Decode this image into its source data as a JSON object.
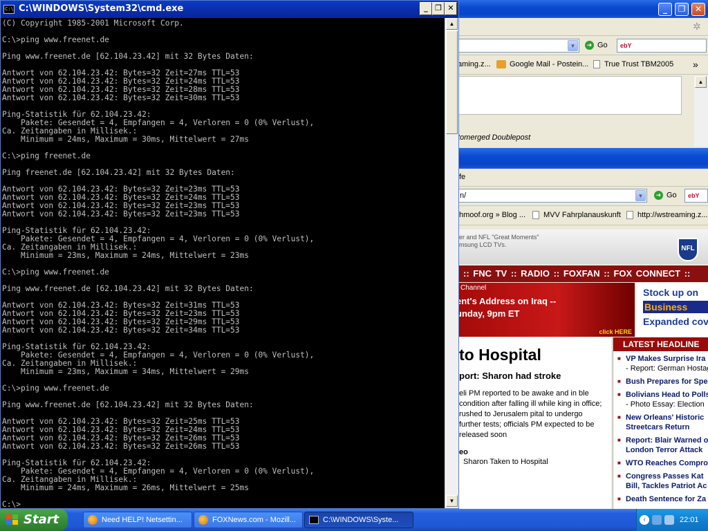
{
  "cmd": {
    "title": "C:\\WINDOWS\\System32\\cmd.exe",
    "icon_text": "C:\\",
    "minimize": "_",
    "maximize": "❐",
    "close": "✕",
    "output": "(C) Copyright 1985-2001 Microsoft Corp.\n\nC:\\>ping www.freenet.de\n\nPing www.freenet.de [62.104.23.42] mit 32 Bytes Daten:\n\nAntwort von 62.104.23.42: Bytes=32 Zeit=27ms TTL=53\nAntwort von 62.104.23.42: Bytes=32 Zeit=24ms TTL=53\nAntwort von 62.104.23.42: Bytes=32 Zeit=28ms TTL=53\nAntwort von 62.104.23.42: Bytes=32 Zeit=30ms TTL=53\n\nPing-Statistik für 62.104.23.42:\n    Pakete: Gesendet = 4, Empfangen = 4, Verloren = 0 (0% Verlust),\nCa. Zeitangaben in Millisek.:\n    Minimum = 24ms, Maximum = 30ms, Mittelwert = 27ms\n\nC:\\>ping freenet.de\n\nPing freenet.de [62.104.23.42] mit 32 Bytes Daten:\n\nAntwort von 62.104.23.42: Bytes=32 Zeit=23ms TTL=53\nAntwort von 62.104.23.42: Bytes=32 Zeit=24ms TTL=53\nAntwort von 62.104.23.42: Bytes=32 Zeit=23ms TTL=53\nAntwort von 62.104.23.42: Bytes=32 Zeit=23ms TTL=53\n\nPing-Statistik für 62.104.23.42:\n    Pakete: Gesendet = 4, Empfangen = 4, Verloren = 0 (0% Verlust),\nCa. Zeitangaben in Millisek.:\n    Minimum = 23ms, Maximum = 24ms, Mittelwert = 23ms\n\nC:\\>ping www.freenet.de\n\nPing www.freenet.de [62.104.23.42] mit 32 Bytes Daten:\n\nAntwort von 62.104.23.42: Bytes=32 Zeit=31ms TTL=53\nAntwort von 62.104.23.42: Bytes=32 Zeit=23ms TTL=53\nAntwort von 62.104.23.42: Bytes=32 Zeit=29ms TTL=53\nAntwort von 62.104.23.42: Bytes=32 Zeit=34ms TTL=53\n\nPing-Statistik für 62.104.23.42:\n    Pakete: Gesendet = 4, Empfangen = 4, Verloren = 0 (0% Verlust),\nCa. Zeitangaben in Millisek.:\n    Minimum = 23ms, Maximum = 34ms, Mittelwert = 29ms\n\nC:\\>ping www.freenet.de\n\nPing www.freenet.de [62.104.23.42] mit 32 Bytes Daten:\n\nAntwort von 62.104.23.42: Bytes=32 Zeit=25ms TTL=53\nAntwort von 62.104.23.42: Bytes=32 Zeit=24ms TTL=53\nAntwort von 62.104.23.42: Bytes=32 Zeit=26ms TTL=53\nAntwort von 62.104.23.42: Bytes=32 Zeit=26ms TTL=53\n\nPing-Statistik für 62.104.23.42:\n    Pakete: Gesendet = 4, Empfangen = 4, Verloren = 0 (0% Verlust),\nCa. Zeitangaben in Millisek.:\n    Minimum = 24ms, Maximum = 26ms, Mittelwert = 25ms\n\nC:\\>",
    "colors": {
      "background": "#000000",
      "text": "#c0c0c0",
      "titlebar": "#0a2ca8"
    }
  },
  "browser_top": {
    "minimize": "_",
    "maximize": "❐",
    "close": "✕",
    "go_label": "Go",
    "search_logo": "ebY",
    "bookmarks": [
      {
        "label": "aming.z..."
      },
      {
        "label": "Google Mail - Postein..."
      },
      {
        "label": "True Trust TBM2005"
      }
    ],
    "chevron": "»",
    "page_text": "tomerged Doublepost"
  },
  "browser_fox": {
    "menu_partial": "fe",
    "address_partial": "n/",
    "go_label": "Go",
    "search_logo": "ebY",
    "bookmarks": [
      {
        "label": "hmoof.org » Blog ..."
      },
      {
        "label": "MVV Fahrplanauskunft"
      },
      {
        "label": "http://wstreaming.z..."
      }
    ],
    "promo_line1": "er and NFL \"Great Moments\"",
    "promo_line2": "msung LCD TVs.",
    "nfl_logo": "NFL",
    "nav": ":: FNC TV :: RADIO :: FOXFAN :: FOX CONNECT ::",
    "banner": {
      "channel": "Channel",
      "line1": "ent's Address on Iraq --",
      "line2": "unday, 9pm ET",
      "click": "click HERE"
    },
    "ad": {
      "line1": "Stock up on",
      "line2": "Business",
      "line3": "Expanded cove"
    },
    "story": {
      "headline": "to Hospital",
      "sub": "port: Sharon had stroke",
      "body": "eli PM reported to be awake and in ble condition after falling ill while king in office; rushed to Jerusalem pital to undergo further tests; officials PM expected to be released soon",
      "video": "eo",
      "link": "Sharon Taken to Hospital"
    },
    "headlines_title": "LATEST HEADLINE",
    "headlines": [
      {
        "text": "VP Makes Surprise Ira",
        "sub": "- Report: German Hostag"
      },
      {
        "text": "Bush Prepares for Spe",
        "sub": ""
      },
      {
        "text": "Bolivians Head to Polls",
        "sub": "- Photo Essay: Election"
      },
      {
        "text": "New Orleans' Historic",
        "sub": "Streetcars Return"
      },
      {
        "text": "Report: Blair Warned o",
        "sub": "London Terror Attack"
      },
      {
        "text": "WTO Reaches Compro",
        "sub": ""
      },
      {
        "text": "Congress Passes Kat",
        "sub": "Bill, Tackles Patriot Ac"
      },
      {
        "text": "Death Sentence for Za",
        "sub": ""
      }
    ]
  },
  "taskbar": {
    "start_label": "Start",
    "tasks": [
      {
        "label": "Need HELP! Netsettin...",
        "active": false
      },
      {
        "label": "FOXNews.com - Mozill...",
        "active": false
      },
      {
        "label": "C:\\WINDOWS\\Syste...",
        "active": true
      }
    ],
    "clock": "22:01"
  }
}
